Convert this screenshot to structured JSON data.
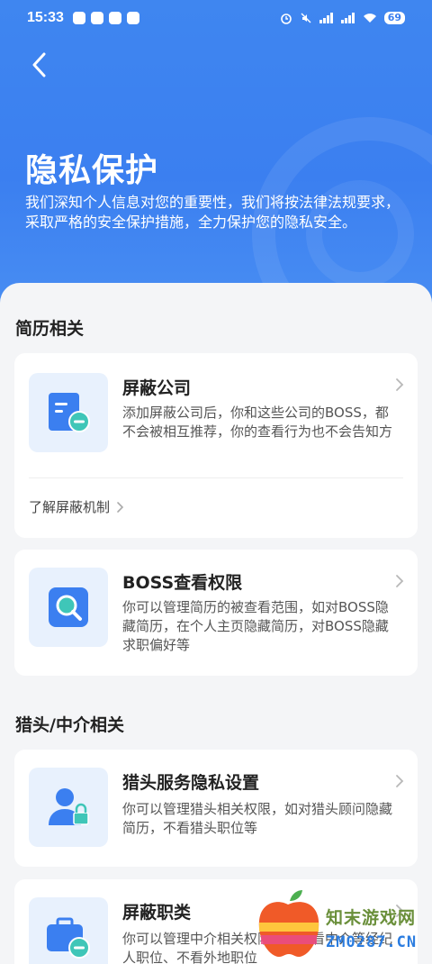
{
  "status_bar": {
    "time": "15:33",
    "battery": "69"
  },
  "header": {
    "title": "隐私保护",
    "description": "我们深知个人信息对您的重要性，我们将按法律法规要求，采取严格的安全保护措施，全力保护您的隐私安全。"
  },
  "sections": [
    {
      "title": "简历相关",
      "cards": [
        {
          "title": "屏蔽公司",
          "desc": "添加屏蔽公司后，你和这些公司的BOSS，都不会被相互推荐，你的查看行为也不会告知方",
          "link": "了解屏蔽机制"
        },
        {
          "title": "BOSS查看权限",
          "desc": "你可以管理简历的被查看范围，如对BOSS隐藏简历，在个人主页隐藏简历，对BOSS隐藏求职偏好等"
        }
      ]
    },
    {
      "title": "猎头/中介相关",
      "cards": [
        {
          "title": "猎头服务隐私设置",
          "desc": "你可以管理猎头相关权限，如对猎头顾问隐藏简历，不看猎头职位等"
        },
        {
          "title": "屏蔽职类",
          "desc": "你可以管理中介相关权限，如不看中介等经纪人职位、不看外地职位"
        }
      ]
    }
  ],
  "watermark": {
    "line1": "知末游戏网",
    "line2": "ZM0287.CN"
  },
  "colors": {
    "primary": "#3b7ff0",
    "icon_bg": "#e8f1fd",
    "accent_teal": "#3fc6b8"
  }
}
